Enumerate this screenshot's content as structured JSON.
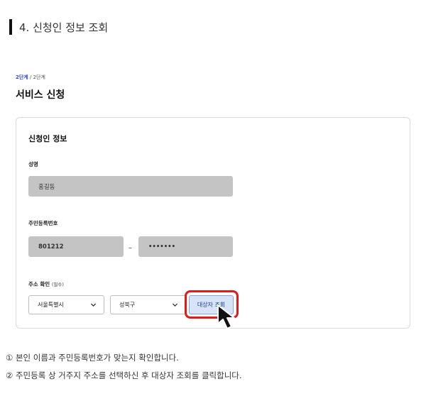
{
  "section": {
    "title": "4. 신청인 정보 조회"
  },
  "steps": {
    "current": "2단계",
    "separator": " / ",
    "total": "2단계"
  },
  "page": {
    "title": "서비스 신청"
  },
  "form": {
    "card_title": "신청인 정보",
    "name": {
      "label": "성명",
      "value": "홍길동"
    },
    "resident_number": {
      "label": "주민등록번호",
      "front": "801212",
      "back": "•••••••"
    },
    "address": {
      "label": "주소 확인",
      "required_note": "(필수)",
      "city": "서울특별시",
      "district": "성북구",
      "lookup_button": "대상자 조회"
    }
  },
  "icons": {
    "dropdown": "chevron-down-icon",
    "cursor": "mouse-pointer-icon"
  },
  "colors": {
    "highlight": "#e01b1b",
    "button_bg": "#d7e4f8",
    "step_accent": "#2d4bd6"
  },
  "notes": [
    "① 본인 이름과 주민등록번호가 맞는지 확인합니다.",
    "② 주민등록 상 거주지 주소를 선택하신 후 대상자 조회를 클릭합니다."
  ]
}
